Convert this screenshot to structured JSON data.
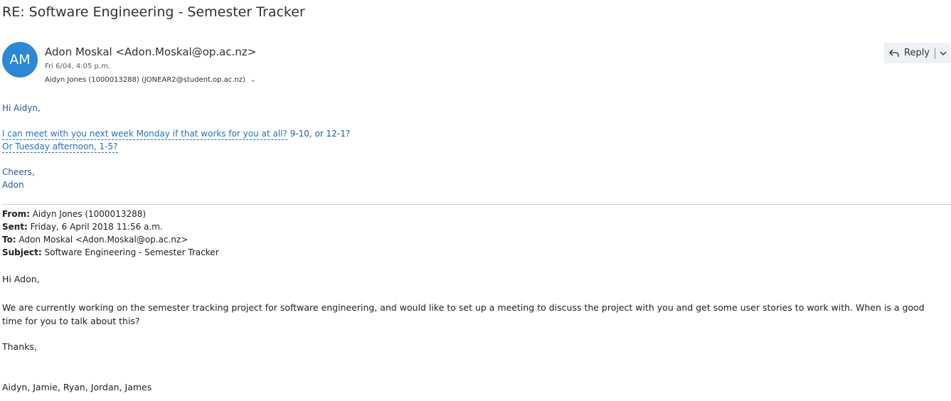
{
  "email": {
    "subject": "RE: Software Engineering - Semester Tracker",
    "avatar_initials": "AM",
    "sender": "Adon Moskal <Adon.Moskal@op.ac.nz>",
    "date": "Fri 6/04, 4:05 p.m.",
    "recipients": "Aidyn Jones (1000013288) (JONEAR2@student.op.ac.nz)",
    "reply_label": "Reply",
    "icons": {
      "reply": "reply-arrow-icon",
      "reply_menu": "chevron-down-icon",
      "expand_recipients": "chevron-down-icon"
    },
    "colors": {
      "avatar_bg": "#2b88d8",
      "reply_bg": "#eef1f5",
      "reply_text_blue": "#1e5a97",
      "link_blue": "#1e73c0"
    }
  },
  "reply_body": {
    "greeting": "Hi Aidyn,",
    "line1_link": "I can meet with you next week Monday if that works for you at all?",
    "line1_rest": " 9-10, or 12-1?",
    "line2_link": "Or Tuesday afternoon, 1-5?",
    "closing": "Cheers,",
    "signature": "Adon"
  },
  "quoted": {
    "from_label": "From:",
    "from_value": " Aidyn Jones (1000013288)",
    "sent_label": "Sent:",
    "sent_value": " Friday, 6 April 2018 11:56 a.m.",
    "to_label": "To:",
    "to_value": " Adon Moskal <Adon.Moskal@op.ac.nz>",
    "subject_label": "Subject:",
    "subject_value": " Software Engineering - Semester Tracker",
    "greeting": "Hi Adon,",
    "paragraph": "We are currently working on the semester tracking project for software engineering, and would like to set up a meeting to discuss the project with you and get some user stories to work with.  When is a good time for you to talk about this?",
    "closing": "Thanks,",
    "signature": "Aidyn, Jamie, Ryan, Jordan, James"
  }
}
